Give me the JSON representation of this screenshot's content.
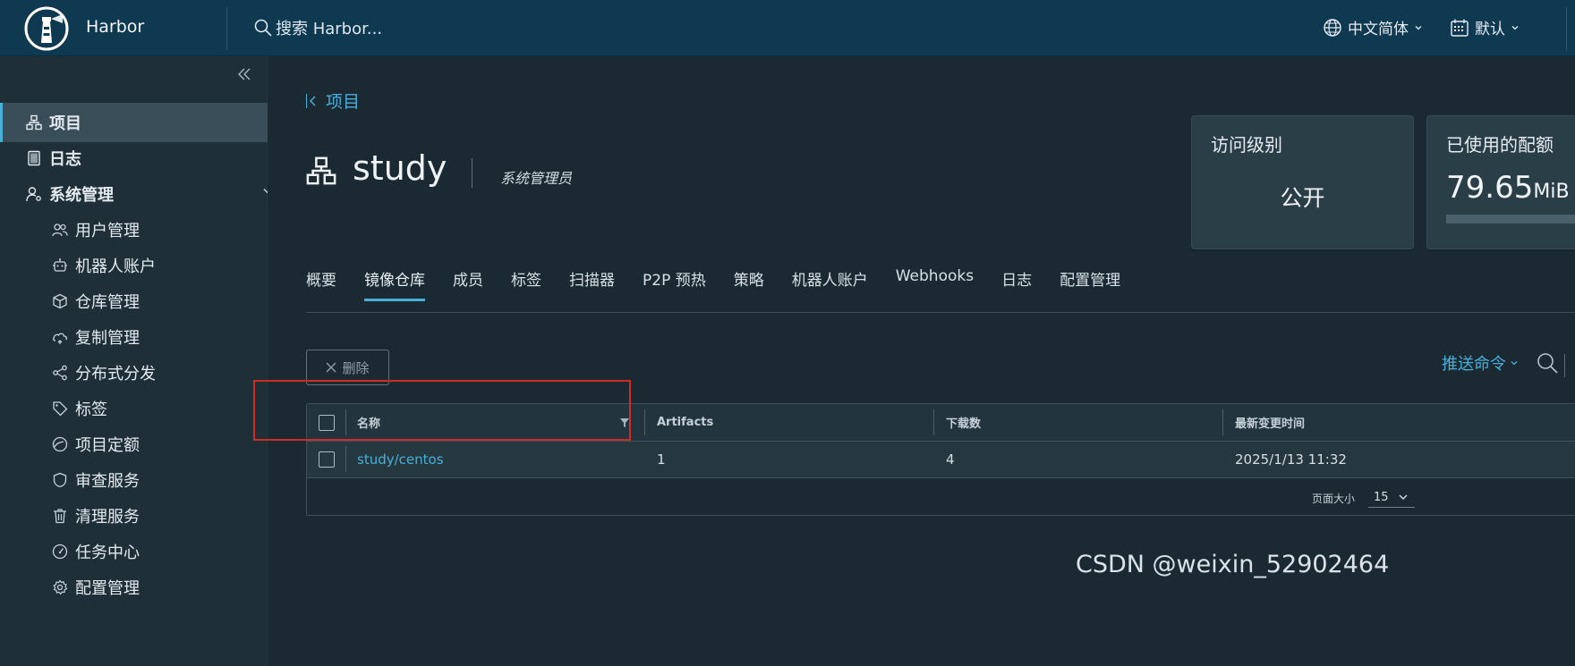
{
  "header": {
    "brand": "Harbor",
    "search_placeholder": "搜索 Harbor...",
    "language": "中文简体",
    "theme": "默认"
  },
  "sidebar": {
    "items": [
      {
        "label": "项目",
        "icon": "project-icon",
        "active": true
      },
      {
        "label": "日志",
        "icon": "log-icon"
      },
      {
        "label": "系统管理",
        "icon": "admin-icon",
        "expanded": true
      }
    ],
    "sub_items": [
      {
        "label": "用户管理",
        "icon": "users-icon"
      },
      {
        "label": "机器人账户",
        "icon": "robot-icon"
      },
      {
        "label": "仓库管理",
        "icon": "registry-icon"
      },
      {
        "label": "复制管理",
        "icon": "replication-icon"
      },
      {
        "label": "分布式分发",
        "icon": "distribution-icon"
      },
      {
        "label": "标签",
        "icon": "tag-icon"
      },
      {
        "label": "项目定额",
        "icon": "quota-icon"
      },
      {
        "label": "审查服务",
        "icon": "shield-icon"
      },
      {
        "label": "清理服务",
        "icon": "trash-icon"
      },
      {
        "label": "任务中心",
        "icon": "dashboard-icon"
      },
      {
        "label": "配置管理",
        "icon": "gear-icon"
      }
    ]
  },
  "main": {
    "back_label": "项目",
    "project_name": "study",
    "role": "系统管理员",
    "cards": {
      "access_title": "访问级别",
      "access_value": "公开",
      "quota_title": "已使用的配额",
      "quota_value": "79.65",
      "quota_unit": "MiB"
    },
    "tabs": [
      "概要",
      "镜像仓库",
      "成员",
      "标签",
      "扫描器",
      "P2P 预热",
      "策略",
      "机器人账户",
      "Webhooks",
      "日志",
      "配置管理"
    ],
    "active_tab": "镜像仓库",
    "toolbar": {
      "delete_label": "删除",
      "push_label": "推送命令"
    },
    "grid": {
      "columns": [
        "名称",
        "Artifacts",
        "下载数",
        "最新变更时间"
      ],
      "rows": [
        {
          "name": "study/centos",
          "artifacts": "1",
          "pulls": "4",
          "updated": "2025/1/13 11:32"
        }
      ],
      "page_size_label": "页面大小",
      "page_size": "15"
    }
  },
  "watermark": "CSDN @weixin_52902464",
  "colors": {
    "accent": "#49afd9",
    "header_bg": "#0f3851",
    "sidebar_bg": "#1e2f38",
    "main_bg": "#1b2a32",
    "highlight": "#d12b22"
  }
}
